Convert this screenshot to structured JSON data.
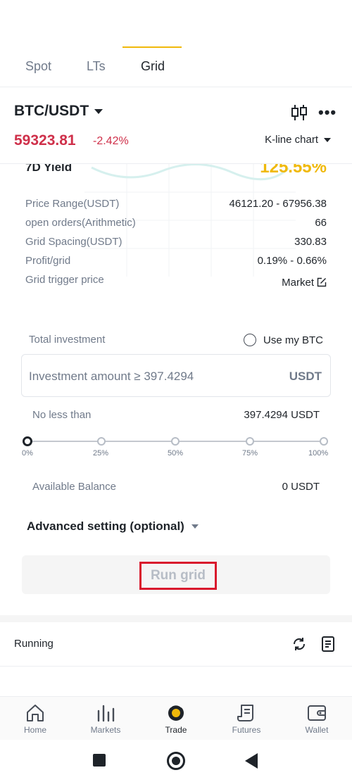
{
  "tabs": [
    {
      "label": "Spot"
    },
    {
      "label": "LTs"
    },
    {
      "label": "Grid"
    }
  ],
  "header": {
    "pair": "BTC/USDT",
    "price": "59323.81",
    "change": "-2.42%",
    "chart_label": "K-line chart"
  },
  "yield": {
    "label": "7D Yield",
    "value": "125.55%"
  },
  "details": [
    {
      "key": "Price Range(USDT)",
      "value": "46121.20 - 67956.38"
    },
    {
      "key": "open orders(Arithmetic)",
      "value": "66"
    },
    {
      "key": "Grid Spacing(USDT)",
      "value": "330.83"
    },
    {
      "key": "Profit/grid",
      "value": "0.19% - 0.66%"
    },
    {
      "key": "Grid trigger price",
      "value": "Market"
    }
  ],
  "investment": {
    "label": "Total investment",
    "use_btc": "Use my BTC",
    "placeholder": "Investment amount  ≥ 397.4294",
    "unit": "USDT",
    "min_label": "No less than",
    "min_value": "397.4294 USDT",
    "slider_percent": 0,
    "slider_marks": [
      "0%",
      "25%",
      "50%",
      "75%",
      "100%"
    ],
    "balance_label": "Available Balance",
    "balance_value": "0 USDT"
  },
  "advanced": {
    "label": "Advanced setting (optional)"
  },
  "run_button": {
    "label": "Run grid"
  },
  "running": {
    "label": "Running"
  },
  "bottom_nav": [
    {
      "label": "Home",
      "icon": "home-icon"
    },
    {
      "label": "Markets",
      "icon": "markets-icon"
    },
    {
      "label": "Trade",
      "icon": "trade-icon"
    },
    {
      "label": "Futures",
      "icon": "futures-icon"
    },
    {
      "label": "Wallet",
      "icon": "wallet-icon"
    }
  ],
  "colors": {
    "accent": "#f0b90b",
    "negative": "#cf304a",
    "highlight": "#d9182d"
  }
}
